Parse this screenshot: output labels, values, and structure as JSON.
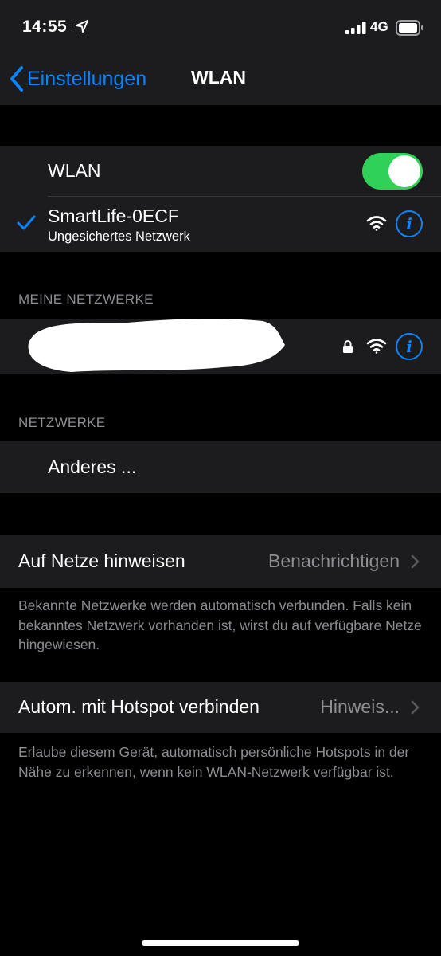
{
  "status_bar": {
    "time": "14:55",
    "network_type": "4G"
  },
  "nav": {
    "back_label": "Einstellungen",
    "title": "WLAN"
  },
  "wlan": {
    "toggle_label": "WLAN",
    "toggle_on": true,
    "connected_network": {
      "name": "SmartLife-0ECF",
      "subtitle": "Ungesichertes Netzwerk"
    }
  },
  "my_networks": {
    "header": "MEINE NETZWERKE"
  },
  "networks": {
    "header": "NETZWERKE",
    "other_label": "Anderes ..."
  },
  "ask_to_join": {
    "label": "Auf Netze hinweisen",
    "value": "Benachrichtigen",
    "footer": "Bekannte Netzwerke werden automatisch verbunden. Falls kein bekanntes Netzwerk vorhanden ist, wirst du auf verfügbare Netze hingewiesen."
  },
  "auto_hotspot": {
    "label": "Autom. mit Hotspot verbinden",
    "value": "Hinweis...",
    "footer": "Erlaube diesem Gerät, automatisch persönliche Hotspots in der Nähe zu erkennen, wenn kein WLAN-Netzwerk verfügbar ist."
  },
  "colors": {
    "accent": "#0a84ff",
    "toggle_on": "#30d158",
    "cell_bg": "#1c1c1e",
    "secondary_text": "#8d8d93"
  }
}
